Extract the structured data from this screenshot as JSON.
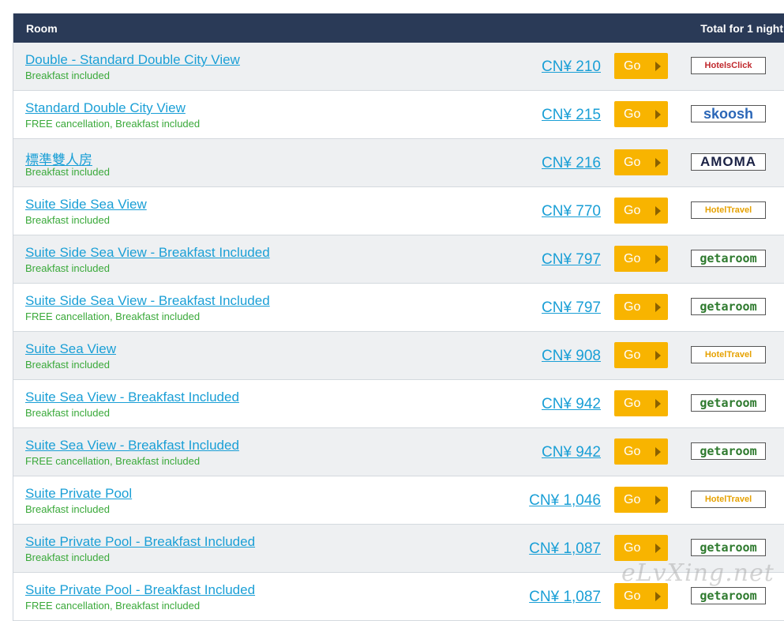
{
  "header": {
    "room_label": "Room",
    "total_label": "Total for 1 night"
  },
  "go_label": "Go",
  "rows": [
    {
      "name": "Double - Standard Double City View",
      "note": "Breakfast included",
      "price": "CN¥ 210",
      "provider": "HotelsClick"
    },
    {
      "name": "Standard Double City View",
      "note": "FREE cancellation, Breakfast included",
      "price": "CN¥ 215",
      "provider": "skoosh"
    },
    {
      "name": "標準雙人房",
      "note": "Breakfast included",
      "price": "CN¥ 216",
      "provider": "AMOMA"
    },
    {
      "name": "Suite Side Sea View",
      "note": "Breakfast included",
      "price": "CN¥ 770",
      "provider": "HotelTravel"
    },
    {
      "name": "Suite Side Sea View - Breakfast Included",
      "note": "Breakfast included",
      "price": "CN¥ 797",
      "provider": "getaroom"
    },
    {
      "name": "Suite Side Sea View - Breakfast Included",
      "note": "FREE cancellation, Breakfast included",
      "price": "CN¥ 797",
      "provider": "getaroom"
    },
    {
      "name": "Suite Sea View",
      "note": "Breakfast included",
      "price": "CN¥ 908",
      "provider": "HotelTravel"
    },
    {
      "name": "Suite Sea View - Breakfast Included",
      "note": "Breakfast included",
      "price": "CN¥ 942",
      "provider": "getaroom"
    },
    {
      "name": "Suite Sea View - Breakfast Included",
      "note": "FREE cancellation, Breakfast included",
      "price": "CN¥ 942",
      "provider": "getaroom"
    },
    {
      "name": "Suite Private Pool",
      "note": "Breakfast included",
      "price": "CN¥ 1,046",
      "provider": "HotelTravel"
    },
    {
      "name": "Suite Private Pool - Breakfast Included",
      "note": "Breakfast included",
      "price": "CN¥ 1,087",
      "provider": "getaroom"
    },
    {
      "name": "Suite Private Pool - Breakfast Included",
      "note": "FREE cancellation, Breakfast included",
      "price": "CN¥ 1,087",
      "provider": "getaroom"
    }
  ],
  "watermark": "eLvXing.net"
}
